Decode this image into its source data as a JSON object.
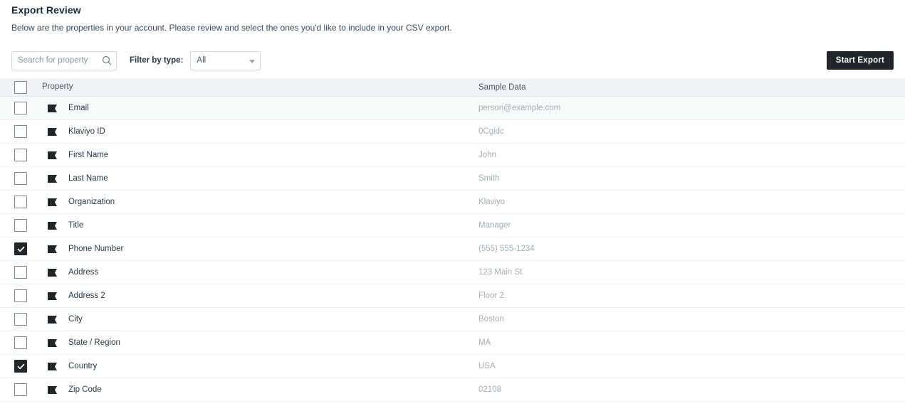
{
  "header": {
    "title": "Export Review",
    "subtitle": "Below are the properties in your account. Please review and select the ones you'd like to include in your CSV export."
  },
  "toolbar": {
    "search_placeholder": "Search for property",
    "search_value": "",
    "search_icon": "search-icon",
    "filter_label": "Filter by type:",
    "filter_selected": "All",
    "filter_options": [
      "All"
    ],
    "start_export_label": "Start Export",
    "accent_dark": "#22262a"
  },
  "table": {
    "columns": {
      "property": "Property",
      "sample_data": "Sample Data"
    },
    "select_all_checked": false,
    "row_icon": "tag-icon",
    "rows": [
      {
        "property": "Email",
        "sample": "person@example.com",
        "checked": false,
        "tinted": true
      },
      {
        "property": "Klaviyo ID",
        "sample": "0Cgidc",
        "checked": false,
        "tinted": false
      },
      {
        "property": "First Name",
        "sample": "John",
        "checked": false,
        "tinted": false
      },
      {
        "property": "Last Name",
        "sample": "Smith",
        "checked": false,
        "tinted": false
      },
      {
        "property": "Organization",
        "sample": "Klaviyo",
        "checked": false,
        "tinted": false
      },
      {
        "property": "Title",
        "sample": "Manager",
        "checked": false,
        "tinted": false
      },
      {
        "property": "Phone Number",
        "sample": "(555) 555-1234",
        "checked": true,
        "tinted": false
      },
      {
        "property": "Address",
        "sample": "123 Main St",
        "checked": false,
        "tinted": false
      },
      {
        "property": "Address 2",
        "sample": "Floor 2",
        "checked": false,
        "tinted": false
      },
      {
        "property": "City",
        "sample": "Boston",
        "checked": false,
        "tinted": false
      },
      {
        "property": "State / Region",
        "sample": "MA",
        "checked": false,
        "tinted": false
      },
      {
        "property": "Country",
        "sample": "USA",
        "checked": true,
        "tinted": false
      },
      {
        "property": "Zip Code",
        "sample": "02108",
        "checked": false,
        "tinted": false
      }
    ]
  }
}
